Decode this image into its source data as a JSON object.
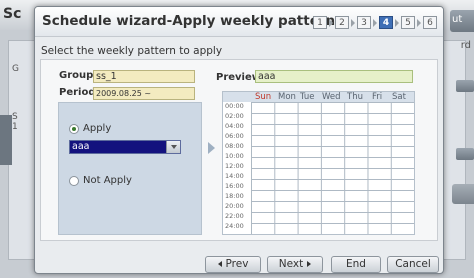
{
  "background": {
    "title_partial": "Sc",
    "out_button_partial": "ut",
    "side_label_g": "G",
    "side_label_s": "S",
    "side_label_1": "1",
    "right_label_rd": "rd"
  },
  "dialog": {
    "title": "Schedule wizard-Apply weekly pattern",
    "steps": [
      "1",
      "2",
      "3",
      "4",
      "5",
      "6"
    ],
    "active_step": "4",
    "subtitle": "Select the weekly pattern to apply"
  },
  "form": {
    "group_label": "Group",
    "group_value": "ss_1",
    "period_label": "Period",
    "period_value": "2009.08.25 ~ 2009.09.25",
    "preview_label": "Preview",
    "preview_value": "aaa"
  },
  "options": {
    "apply_label": "Apply",
    "apply_checked": true,
    "pattern_selected": "aaa",
    "not_apply_label": "Not Apply",
    "not_apply_checked": false
  },
  "preview": {
    "days": [
      "Sun",
      "Mon",
      "Tue",
      "Wed",
      "Thu",
      "Fri",
      "Sat"
    ],
    "hours": [
      "00:00",
      "02:00",
      "04:00",
      "06:00",
      "08:00",
      "10:00",
      "12:00",
      "14:00",
      "16:00",
      "18:00",
      "20:00",
      "22:00",
      "24:00"
    ]
  },
  "footer": {
    "prev_label": "Prev",
    "next_label": "Next",
    "end_label": "End",
    "cancel_label": "Cancel"
  },
  "colors": {
    "active_step": "#3f6fb6",
    "selection": "#13127e",
    "sunday": "#c0392b",
    "field_bg": "#f3ebc0"
  }
}
